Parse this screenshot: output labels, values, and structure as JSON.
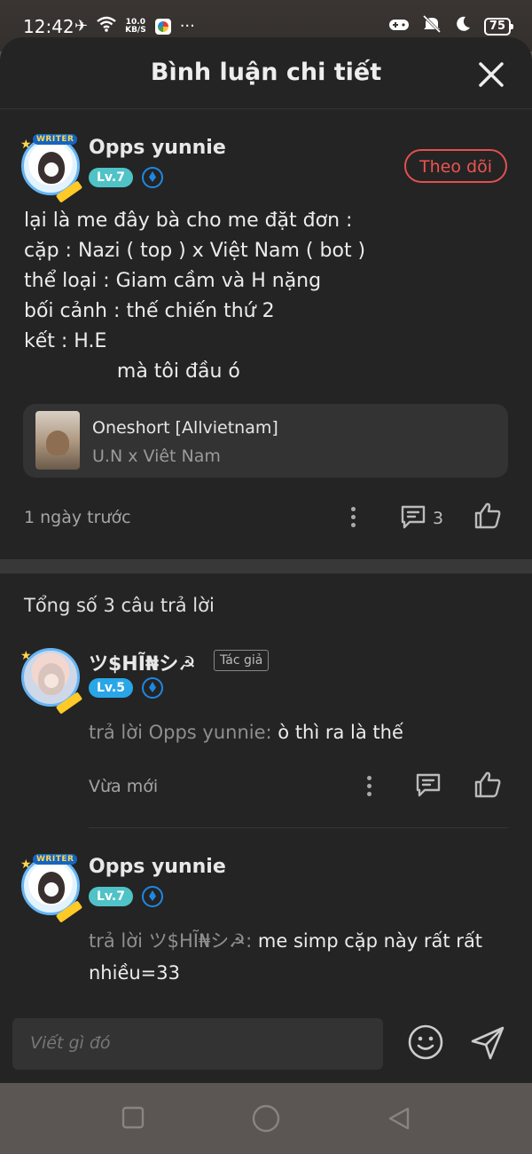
{
  "status_bar": {
    "time": "12:42",
    "net_speed_value": "10.0",
    "net_speed_unit": "KB/S",
    "battery": "75"
  },
  "header": {
    "title": "Bình luận chi tiết"
  },
  "main_comment": {
    "username": "Opps yunnie",
    "level": "Lv.7",
    "follow_label": "Theo dõi",
    "text": "lại là me đây bà cho me đặt đơn :\ncặp : Nazi ( top ) x Việt Nam ( bot )\nthể loại : Giam cầm và H nặng\nbối cảnh : thế chiến thứ 2\nkết : H.E\n               mà tôi đầu ó",
    "story": {
      "title": "Oneshort [Allvietnam]",
      "subtitle": "U.N x Viêt Nam"
    },
    "time": "1 ngày trước",
    "reply_count": "3"
  },
  "replies_section": {
    "total_label": "Tổng số 3 câu trả lời",
    "replies": [
      {
        "username": "ツ$HĨ₦シ☭",
        "author_tag": "Tác giả",
        "level": "Lv.5",
        "reply_prefix": "trả lời Opps yunnie:",
        "text": "ò thì ra là thế",
        "time": "Vừa mới"
      },
      {
        "username": "Opps yunnie",
        "level": "Lv.7",
        "reply_prefix": "trả lời ツ$HĨ₦シ☭:",
        "text": "me simp cặp này rất rất",
        "text_line2": "nhiều=33"
      }
    ]
  },
  "composer": {
    "placeholder": "Viết gì đó"
  },
  "colors": {
    "background": "#242424",
    "follow_accent": "#ef5350",
    "level7": "#4fc3c7",
    "level5": "#29a6e8"
  },
  "icons": [
    "airplane-icon",
    "wifi-icon",
    "app-icon",
    "more-icon",
    "game-icon",
    "mute-icon",
    "moon-icon",
    "battery-icon",
    "close-icon",
    "gem-icon",
    "more-dots-icon",
    "comment-icon",
    "like-icon",
    "emoji-icon",
    "send-icon",
    "nav-recent-icon",
    "nav-home-icon",
    "nav-back-icon"
  ]
}
